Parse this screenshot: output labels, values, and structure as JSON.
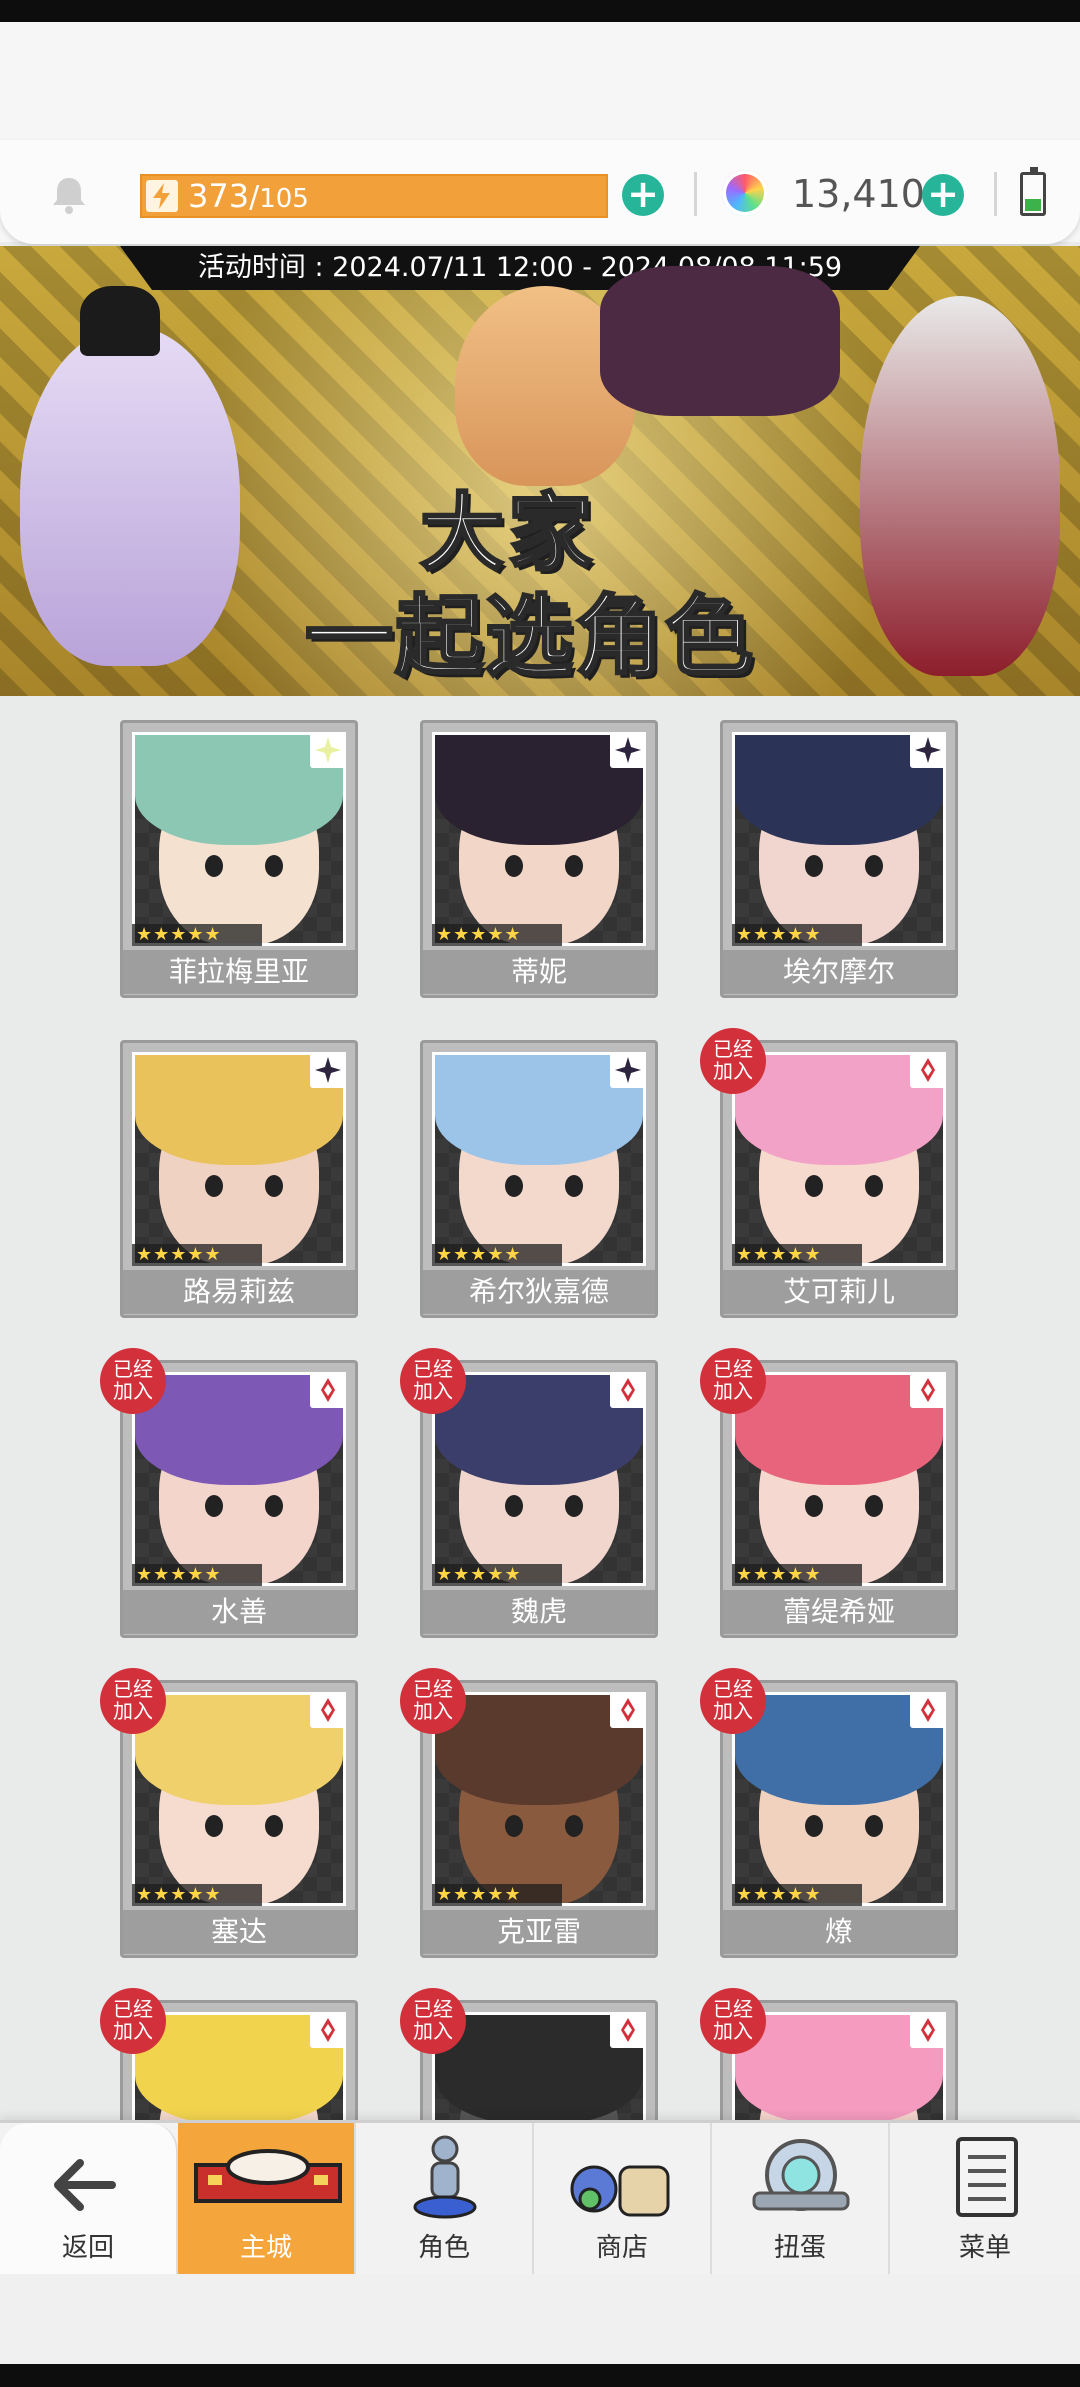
{
  "header": {
    "energy_current": "373",
    "energy_sep": "/",
    "energy_max": "105",
    "gems": "13,410",
    "icons": [
      "bell-icon",
      "lightning-icon",
      "plus-icon",
      "gem-icon",
      "battery-icon"
    ]
  },
  "banner": {
    "event_time": "活动时间 : 2024.07/11 12:00 - 2024.08/08 11:59",
    "title_line1": "大家",
    "title_line2": "一起选角色"
  },
  "characters": [
    {
      "name": "菲拉梅里亚",
      "stars": "★★★★★",
      "joined": false
    },
    {
      "name": "蒂妮",
      "stars": "★★★★★",
      "joined": false
    },
    {
      "name": "埃尔摩尔",
      "stars": "★★★★★",
      "joined": false
    },
    {
      "name": "路易莉兹",
      "stars": "★★★★★",
      "joined": false
    },
    {
      "name": "希尔狄嘉德",
      "stars": "★★★★★",
      "joined": false
    },
    {
      "name": "艾可莉儿",
      "stars": "★★★★★",
      "joined": true
    },
    {
      "name": "水善",
      "stars": "★★★★★",
      "joined": true
    },
    {
      "name": "魏虎",
      "stars": "★★★★★",
      "joined": true
    },
    {
      "name": "蕾缇希娅",
      "stars": "★★★★★",
      "joined": true
    },
    {
      "name": "塞达",
      "stars": "★★★★★",
      "joined": true
    },
    {
      "name": "克亚雷",
      "stars": "★★★★★",
      "joined": true
    },
    {
      "name": "燎",
      "stars": "★★★★★",
      "joined": true
    },
    {
      "name": "",
      "stars": "",
      "joined": true
    },
    {
      "name": "",
      "stars": "",
      "joined": true
    },
    {
      "name": "",
      "stars": "",
      "joined": true
    }
  ],
  "joined_badge": "已经\n加入",
  "nav": {
    "back": "返回",
    "main_city": "主城",
    "roles": "角色",
    "shop": "商店",
    "gacha": "扭蛋",
    "menu": "菜单"
  },
  "colors": {
    "energy_bar": "#f2a13a",
    "plus_button": "#27b59a",
    "joined_badge": "#d2303a",
    "active_tab": "#f4a63c"
  }
}
